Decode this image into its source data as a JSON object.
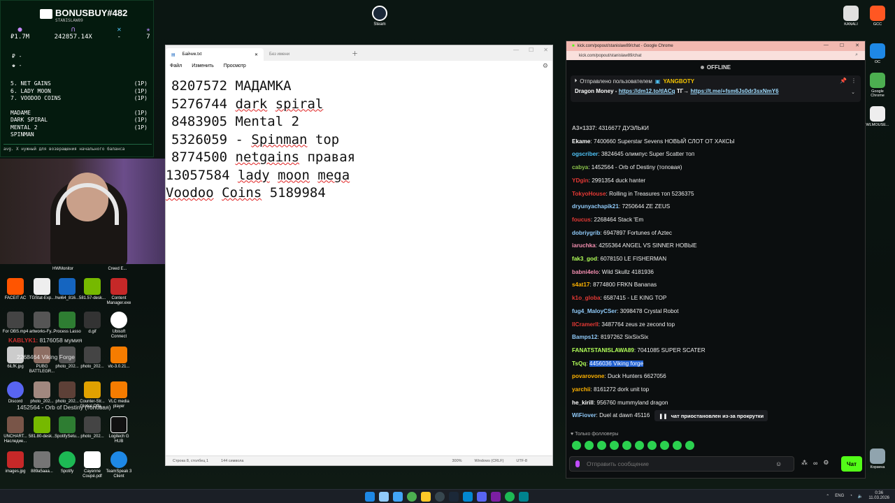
{
  "bonus": {
    "title": "BONUSBUY#482",
    "subtitle": "STANISLAW89",
    "stats": [
      {
        "icon": "circle-icon",
        "value": "₽1.7M"
      },
      {
        "icon": "headphones-icon",
        "value": "242857.14X"
      },
      {
        "icon": "cross-icon",
        "value": "-"
      },
      {
        "icon": "star-icon",
        "value": "7"
      }
    ],
    "rows": [
      "₽ -",
      "♚ -"
    ],
    "list": [
      {
        "name": "5. NET GAINS",
        "tag": "(1P)"
      },
      {
        "name": "6. LADY MOON",
        "tag": "(1P)"
      },
      {
        "name": "7. VOODOO COINS",
        "tag": "(1P)"
      },
      {
        "name": "MADAME",
        "tag": "(1P)"
      },
      {
        "name": "DARK SPIRAL",
        "tag": "(1P)"
      },
      {
        "name": "MENTAL 2",
        "tag": "(1P)"
      },
      {
        "name": "SPINMAN",
        "tag": ""
      }
    ],
    "ticker": "avg. X нужный для возвращения начального баланса"
  },
  "desktop_chat": [
    {
      "user": "KABLYK1:",
      "text": "8176058 мумия"
    },
    {
      "user": "",
      "text": "2268464 Viking Forge"
    },
    {
      "user": "",
      "text": "1452564 - Orb of Destiny (топовая)"
    }
  ],
  "steam_label": "Steam",
  "notepad": {
    "tabs": {
      "active": "Байчик.txt",
      "inactive": "Без имени"
    },
    "menu": [
      "Файл",
      "Изменить",
      "Просмотр"
    ],
    "lines": [
      {
        "parts": [
          {
            "t": "8207572 МАДАМКА",
            "sq": false
          }
        ]
      },
      {
        "parts": [
          {
            "t": "5276744 ",
            "sq": false
          },
          {
            "t": "dark",
            "sq": true
          },
          {
            "t": " ",
            "sq": false
          },
          {
            "t": "spiral",
            "sq": true
          }
        ]
      },
      {
        "parts": [
          {
            "t": "8483905 Mental 2",
            "sq": false
          }
        ]
      },
      {
        "parts": [
          {
            "t": "5326059 - ",
            "sq": false
          },
          {
            "t": "Spinman",
            "sq": true
          },
          {
            "t": " top",
            "sq": false
          }
        ]
      },
      {
        "parts": [
          {
            "t": "8774500 ",
            "sq": false
          },
          {
            "t": "netgains",
            "sq": true
          },
          {
            "t": " правая",
            "sq": false
          }
        ]
      },
      {
        "parts": [
          {
            "t": "13057584 ",
            "sq": false
          },
          {
            "t": "lady",
            "sq": true
          },
          {
            "t": " ",
            "sq": false
          },
          {
            "t": "moon",
            "sq": true
          },
          {
            "t": " ",
            "sq": false
          },
          {
            "t": "mega",
            "sq": true
          }
        ]
      },
      {
        "parts": [
          {
            "t": "Voodoo",
            "sq": true
          },
          {
            "t": " ",
            "sq": false
          },
          {
            "t": "Coins",
            "sq": true
          },
          {
            "t": " 5189984",
            "sq": false
          }
        ]
      }
    ],
    "status": [
      "Строка 8, столбец 1",
      "144 символа",
      "300%",
      "Windows (CRLF)",
      "UTF-8"
    ]
  },
  "chrome": {
    "title": "kick.com/popout/stanislaw89/chat - Google Chrome",
    "url": "kick.com/popout/stanislaw89/chat",
    "offline": "OFFLINE",
    "pinned": {
      "sent_by": "Отправлено пользователем",
      "bot": "YANGBOTY",
      "text": "Dragon Money -",
      "link1": "https://dm12.to/tIACq",
      "tg": "ТГ→",
      "link2": "https://t.me/+fsm6Js0dr3sxNmY6"
    },
    "messages": [
      {
        "user": "A3×1337",
        "color": "#c0c0c0",
        "text": "4316677 ДУЭЛЬКИ"
      },
      {
        "user": "Ekame",
        "color": "#ffffff",
        "text": "7400660 Superstar Sevens НОВЫЙ СЛОТ ОТ ХАКСЫ"
      },
      {
        "user": "ogscriber",
        "color": "#4fc3f7",
        "text": "3824645 олимпус Super Scatter топ"
      },
      {
        "user": "cabya",
        "color": "#8bc34a",
        "text": "1452564 - Orb of Destiny (топовая)"
      },
      {
        "user": "YDgin",
        "color": "#e53935",
        "text": "2991354 duck hanter"
      },
      {
        "user": "TokyoHouse",
        "color": "#e53935",
        "text": "Rolling in Treasures топ 5236375"
      },
      {
        "user": "dryunyachapik21",
        "color": "#90caf9",
        "text": "7250644 ZE ZEUS"
      },
      {
        "user": "foucus",
        "color": "#e53935",
        "text": "2268464 Stack 'Em"
      },
      {
        "user": "dobriygrib",
        "color": "#90caf9",
        "text": "6947897 Fortunes of Aztec"
      },
      {
        "user": "iaruchka",
        "color": "#f48fb1",
        "text": "4255364 ANGEL VS SINNER НОВЫЕ"
      },
      {
        "user": "fak3_god",
        "color": "#b2ff59",
        "text": "6078150 LE FISHERMAN"
      },
      {
        "user": "babni4elo",
        "color": "#f48fb1",
        "text": "Wild Skullz 4181936"
      },
      {
        "user": "s4at17",
        "color": "#ffb300",
        "text": "8774800 FRKN Bananas"
      },
      {
        "user": "k1o_globa",
        "color": "#e53935",
        "text": "6587415 - LE KING TOP"
      },
      {
        "user": "fug4_MaloyCSer",
        "color": "#90caf9",
        "text": "3098478 Crystal Robot"
      },
      {
        "user": "llCramerll",
        "color": "#e53935",
        "text": "3487764 zeus ze zecond top"
      },
      {
        "user": "Bamps12",
        "color": "#90caf9",
        "text": "8197262 SixSixSix"
      },
      {
        "user": "FANATSTANISLAWA89",
        "color": "#b2ff59",
        "text": "7041085 SUPER SCATER"
      },
      {
        "user": "TsQq",
        "color": "#b2ff59",
        "text": "4456036 Viking forge",
        "highlight": true
      },
      {
        "user": "povarovone",
        "color": "#ffb300",
        "text": "Duck Hunters 6627056"
      },
      {
        "user": "yarchii",
        "color": "#ffb300",
        "text": "8161272 dork unit top"
      },
      {
        "user": "he_kirill",
        "color": "#ffffff",
        "text": "956760 mummyland dragon"
      },
      {
        "user": "WiFiover",
        "color": "#90caf9",
        "text": "Duel at dawn 45116"
      }
    ],
    "paused": "чат приостановлен из-за прокрутки",
    "followers_only": "Только фолловеры",
    "input_placeholder": "Отправить сообщение",
    "send_label": "Чат"
  },
  "right_icons": [
    {
      "label": "KANALI",
      "color": "#e0e0e0"
    },
    {
      "label": "GCC",
      "color": "#ff5722"
    },
    {
      "label": "OC",
      "color": "#1e88e5"
    },
    {
      "label": "Google Chrome",
      "color": "#4caf50"
    },
    {
      "label": "WLMOUSE...",
      "color": "#eeeeee"
    },
    {
      "label": "Корзина",
      "color": "#90a4ae"
    }
  ],
  "taskbar": {
    "lang": "ENG",
    "time": "0:36",
    "date": "11.03.2026"
  }
}
